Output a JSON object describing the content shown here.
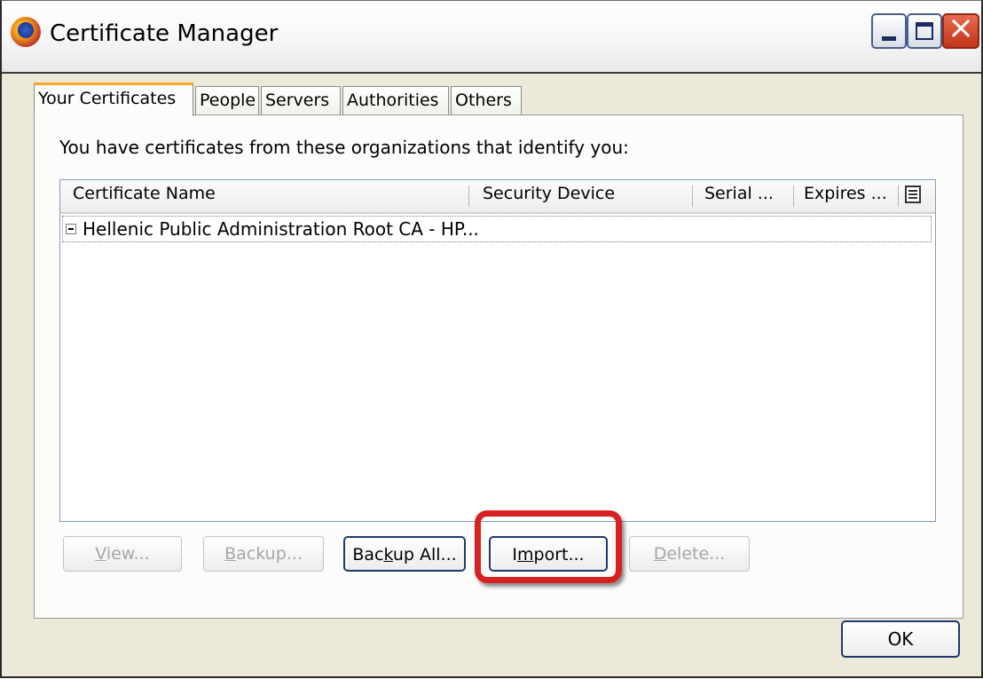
{
  "window": {
    "title": "Certificate Manager",
    "controls": {
      "minimize": "minimize-icon",
      "maximize": "maximize-icon",
      "close": "close-icon"
    }
  },
  "tabs": [
    {
      "label": "Your Certificates",
      "active": true
    },
    {
      "label": "People",
      "active": false
    },
    {
      "label": "Servers",
      "active": false
    },
    {
      "label": "Authorities",
      "active": false
    },
    {
      "label": "Others",
      "active": false
    }
  ],
  "panel": {
    "intro": "You have certificates from these organizations that identify you:"
  },
  "tree": {
    "columns": [
      "Certificate Name",
      "Security Device",
      "Serial ...",
      "Expires ..."
    ],
    "rows": [
      {
        "label": "Hellenic Public Administration Root CA - HP...",
        "expanded": true
      }
    ]
  },
  "buttons": {
    "view": {
      "before": "",
      "accel": "V",
      "after": "iew...",
      "enabled": false
    },
    "backup": {
      "before": "",
      "accel": "B",
      "after": "ackup...",
      "enabled": false
    },
    "backup_all": {
      "before": "Bac",
      "accel": "k",
      "after": "up All...",
      "enabled": true
    },
    "import": {
      "before": "I",
      "accel": "m",
      "after": "port...",
      "enabled": true
    },
    "delete": {
      "before": "",
      "accel": "D",
      "after": "elete...",
      "enabled": false
    }
  },
  "ok_label": "OK",
  "colors": {
    "highlight": "#d62121",
    "tab_accent": "#f5a623",
    "button_border": "#1e3a6c"
  }
}
